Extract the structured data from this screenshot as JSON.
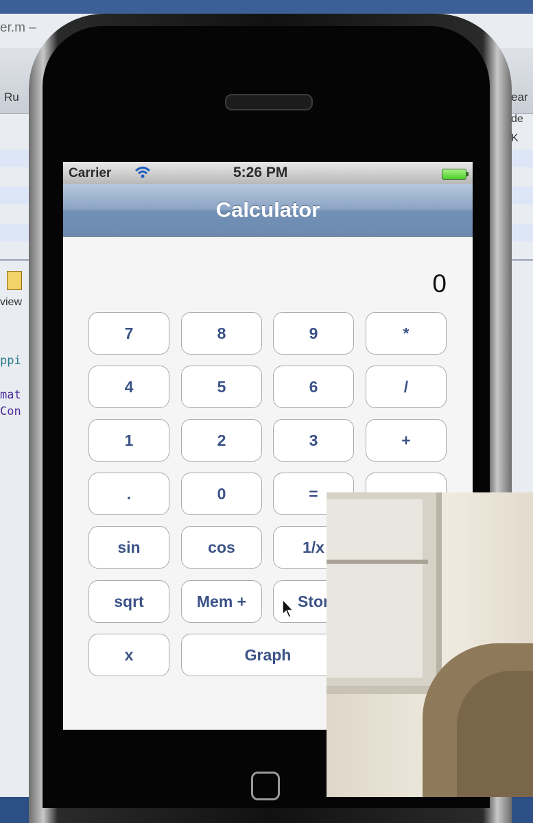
{
  "background_window": {
    "title_fragment": "er.m –",
    "toolbar_left": "Ru",
    "toolbar_right": [
      "ear",
      "de",
      "K"
    ],
    "code_lines": [
      "ppi",
      "mat",
      "Con"
    ],
    "view_label": "view"
  },
  "statusbar": {
    "carrier": "Carrier",
    "time": "5:26 PM"
  },
  "navbar": {
    "title": "Calculator"
  },
  "display": {
    "value": "0"
  },
  "buttons": {
    "b7": "7",
    "b8": "8",
    "b9": "9",
    "mul": "*",
    "b4": "4",
    "b5": "5",
    "b6": "6",
    "div": "/",
    "b1": "1",
    "b2": "2",
    "b3": "3",
    "add": "+",
    "dot": ".",
    "b0": "0",
    "eq": "=",
    "sin": "sin",
    "cos": "cos",
    "recip": "1/x",
    "sqrt": "sqrt",
    "mem_plus": "Mem +",
    "store": "Stor",
    "x": "x",
    "graph": "Graph"
  },
  "colors": {
    "nav_bar": "#7391b7",
    "button_text": "#3c5387",
    "battery": "#4bcf2a"
  }
}
